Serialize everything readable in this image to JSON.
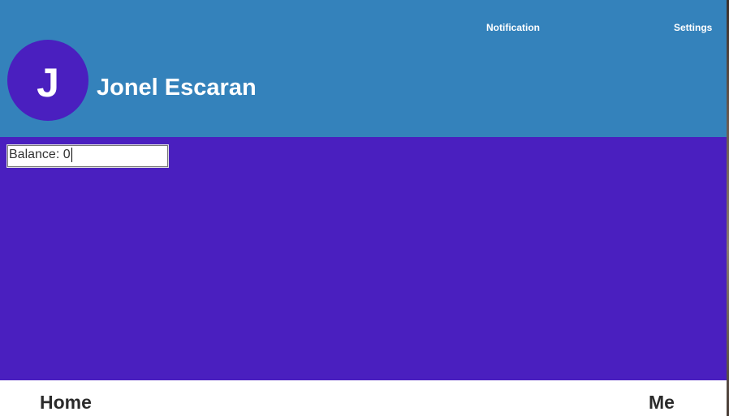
{
  "header": {
    "links": {
      "notification": "Notification",
      "settings": "Settings"
    },
    "profile": {
      "avatar_initial": "J",
      "name": "Jonel Escaran"
    }
  },
  "main": {
    "balance_field": {
      "value": "Balance: 0"
    }
  },
  "bottom_nav": {
    "home": "Home",
    "me": "Me"
  },
  "colors": {
    "header_bg": "#3482bb",
    "content_bg": "#4a1fbf",
    "avatar_bg": "#4a1fbf",
    "nav_bg": "#ffffff",
    "nav_text": "#2b2b2b"
  }
}
